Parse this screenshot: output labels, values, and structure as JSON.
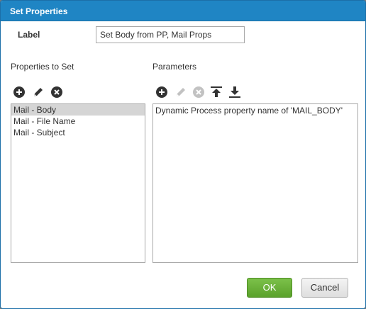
{
  "dialog": {
    "title": "Set Properties"
  },
  "label_field": {
    "caption": "Label",
    "value": "Set Body from PP, Mail Props"
  },
  "properties": {
    "heading": "Properties to Set",
    "toolbar": [
      "add-icon",
      "edit-icon",
      "remove-icon"
    ],
    "items": [
      {
        "label": "Mail - Body",
        "selected": true
      },
      {
        "label": "Mail - File Name",
        "selected": false
      },
      {
        "label": "Mail - Subject",
        "selected": false
      }
    ]
  },
  "parameters": {
    "heading": "Parameters",
    "toolbar": [
      "add-icon",
      "edit-icon",
      "remove-icon",
      "move-up-icon",
      "move-down-icon"
    ],
    "items": [
      {
        "label": "Dynamic Process property name of 'MAIL_BODY'"
      }
    ]
  },
  "buttons": {
    "ok": "OK",
    "cancel": "Cancel"
  },
  "colors": {
    "titlebar": "#1f85c4",
    "ok_button": "#5aa12b",
    "selected_row": "#d5d5d5"
  }
}
